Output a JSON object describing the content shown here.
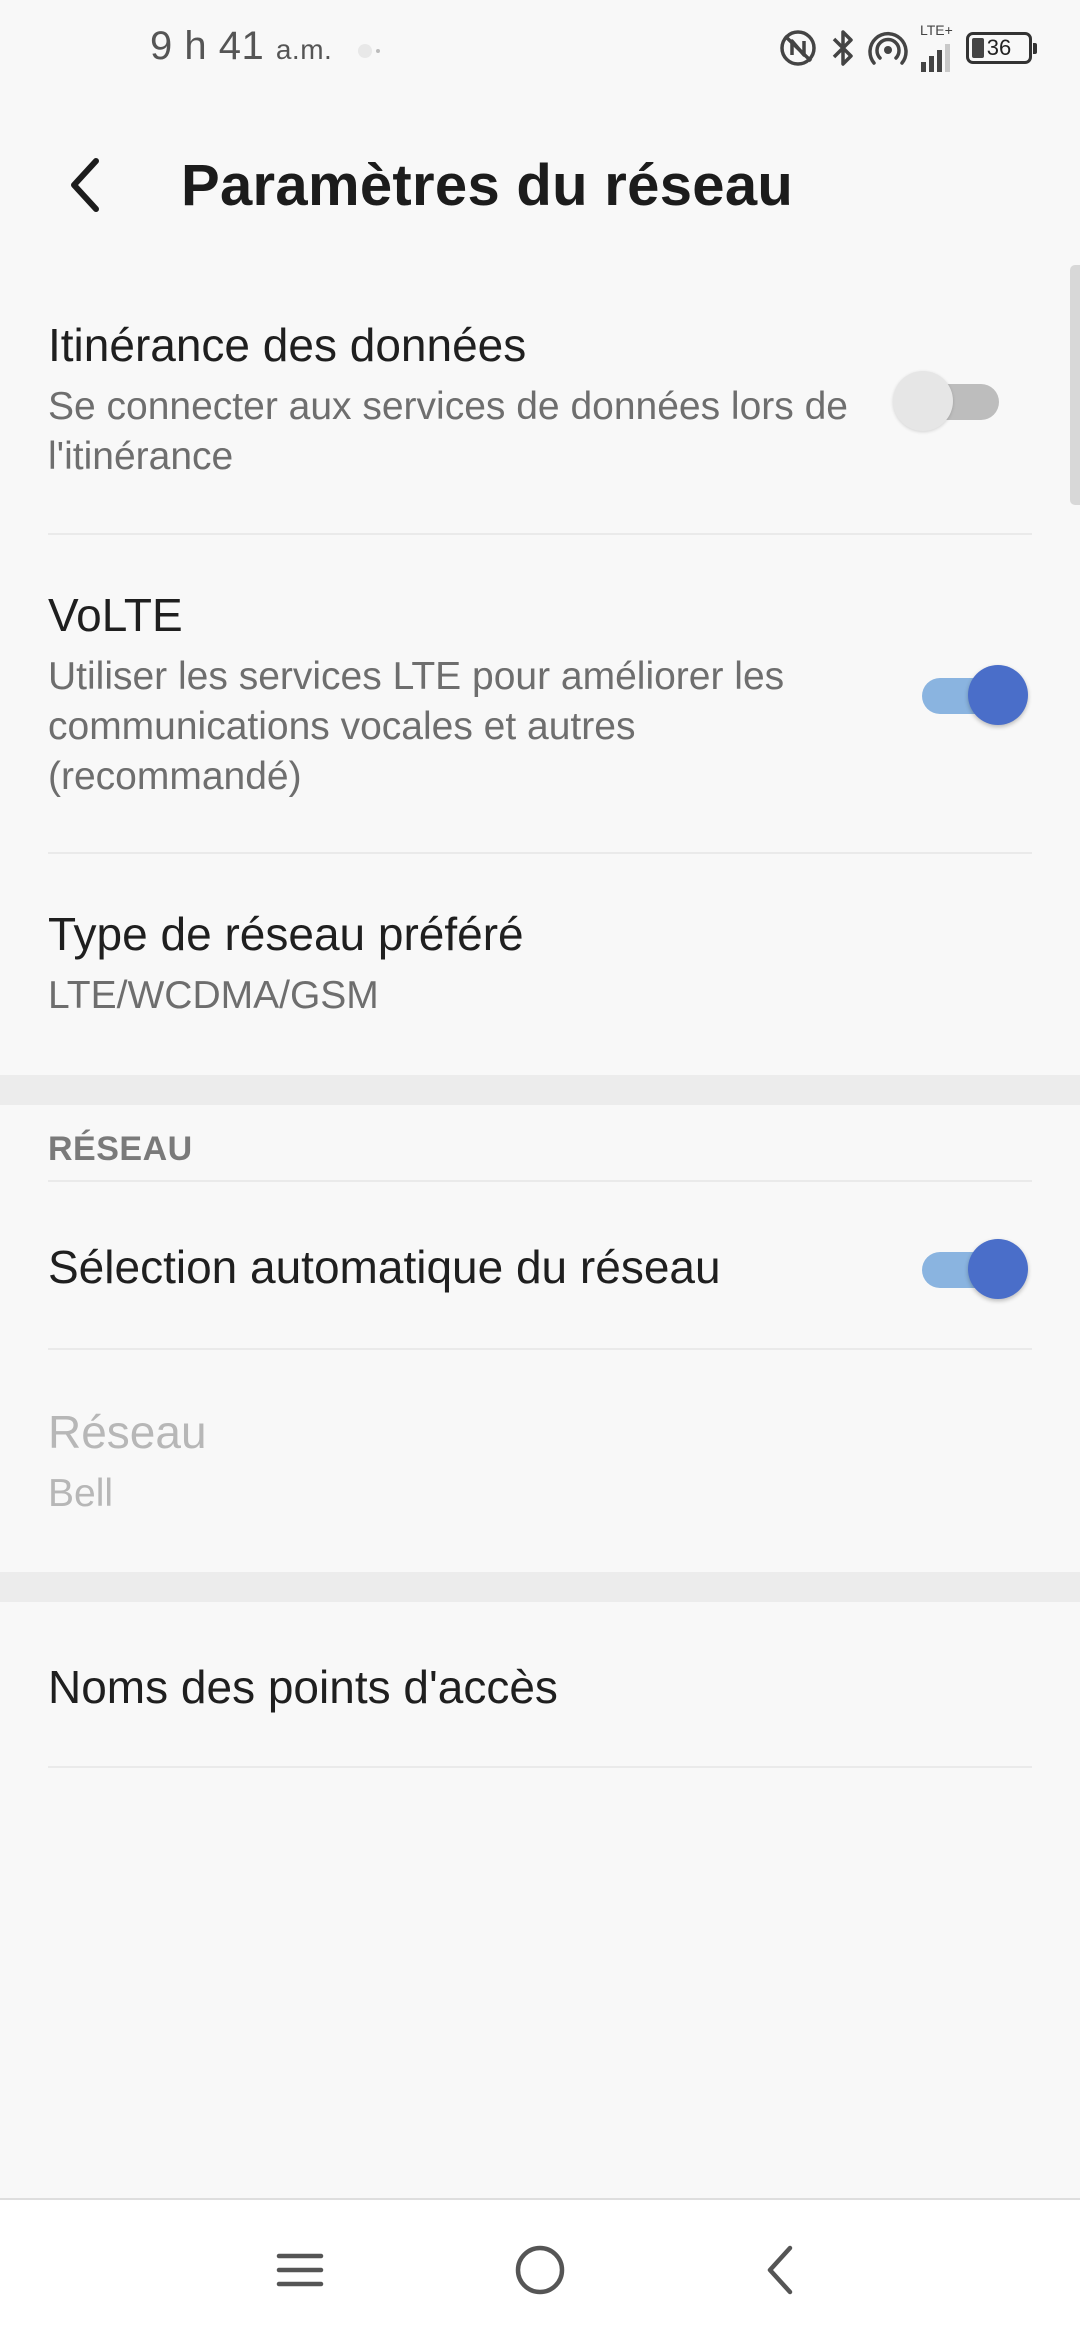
{
  "status_bar": {
    "time": "9 h 41",
    "ampm": "a.m.",
    "network_type": "LTE+",
    "battery_level": "36"
  },
  "header": {
    "title": "Paramètres du réseau"
  },
  "settings": {
    "roaming": {
      "title": "Itinérance des données",
      "summary": "Se connecter aux services de données lors de l'itinérance",
      "enabled": false
    },
    "volte": {
      "title": "VoLTE",
      "summary": "Utiliser les services LTE pour améliorer les communications vocales et autres (recommandé)",
      "enabled": true
    },
    "preferred_network": {
      "title": "Type de réseau préféré",
      "value": "LTE/WCDMA/GSM"
    }
  },
  "network_section": {
    "header": "RÉSEAU",
    "auto_select": {
      "title": "Sélection automatique du réseau",
      "enabled": true
    },
    "network": {
      "title": "Réseau",
      "value": "Bell"
    }
  },
  "apn": {
    "title": "Noms des points d'accès"
  },
  "colors": {
    "accent": "#4a6ec9",
    "accent_track": "#8ab4e0",
    "background": "#f8f8f8"
  },
  "nav_icons": [
    "menu-icon",
    "home-icon",
    "back-icon"
  ]
}
